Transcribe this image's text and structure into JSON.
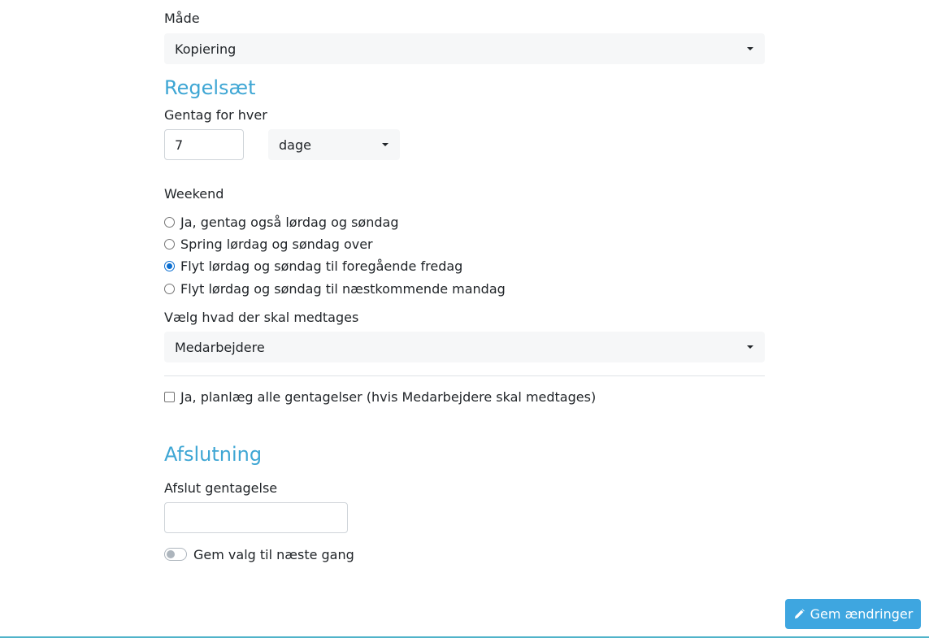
{
  "mode": {
    "label": "Måde",
    "value": "Kopiering"
  },
  "ruleset": {
    "heading": "Regelsæt",
    "repeat_label": "Gentag for hver",
    "repeat_value": "7",
    "unit_value": "dage"
  },
  "weekend": {
    "label": "Weekend",
    "options": [
      {
        "label": "Ja, gentag også lørdag og søndag",
        "checked": false
      },
      {
        "label": "Spring lørdag og søndag over",
        "checked": false
      },
      {
        "label": "Flyt lørdag og søndag til foregående fredag",
        "checked": true
      },
      {
        "label": "Flyt lørdag og søndag til næstkommende mandag",
        "checked": false
      }
    ]
  },
  "include": {
    "label": "Vælg hvad der skal medtages",
    "value": "Medarbejdere"
  },
  "plan_all": {
    "label": "Ja, planlæg alle gentagelser (hvis Medarbejdere skal medtages)",
    "checked": false
  },
  "ending": {
    "heading": "Afslutning",
    "end_label": "Afslut gentagelse",
    "end_value": "",
    "remember_label": "Gem valg til næste gang",
    "remember_on": false
  },
  "save_button": {
    "label": "Gem ændringer",
    "icon": "pencil-icon"
  },
  "colors": {
    "accent": "#3ea6d4",
    "button": "#3ea6e0",
    "radio_checked": "#0a6ed1"
  }
}
